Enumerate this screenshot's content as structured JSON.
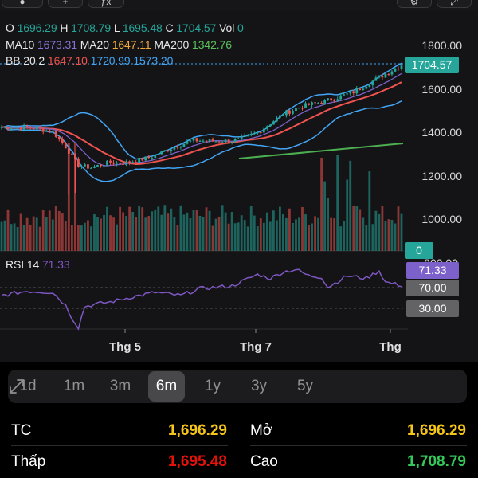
{
  "toolbar": {
    "indicator_label": "ƒx"
  },
  "legend": {
    "ohlc": {
      "o_label": "O",
      "o": "1696.29",
      "h_label": "H",
      "h": "1708.79",
      "l_label": "L",
      "l": "1695.48",
      "c_label": "C",
      "c": "1704.57",
      "vol_label": "Vol",
      "vol": "0"
    },
    "ma": {
      "ma10_label": "MA10",
      "ma10": "1673.31",
      "ma20_label": "MA20",
      "ma20": "1647.11",
      "ma200_label": "MA200",
      "ma200": "1342.76"
    },
    "bb": {
      "label": "BB 20 2",
      "middle": "1647.10",
      "upper": "1720.99",
      "lower": "1573.20"
    },
    "rsi": {
      "label": "RSI 14",
      "value": "71.33"
    }
  },
  "price_axis": {
    "ticks": [
      "1800.00",
      "1600.00",
      "1400.00",
      "1200.00",
      "1000.00"
    ],
    "current_price": "1704.57",
    "volume_current": "0",
    "rsi_partial_tick": "800.00"
  },
  "rsi_axis": {
    "current": "71.33",
    "overbought": "70.00",
    "oversold": "30.00"
  },
  "time_axis": [
    "Thg 5",
    "Thg 7",
    "Thg"
  ],
  "periods": [
    {
      "label": "1d",
      "active": false
    },
    {
      "label": "1m",
      "active": false
    },
    {
      "label": "3m",
      "active": false
    },
    {
      "label": "6m",
      "active": true
    },
    {
      "label": "1y",
      "active": false
    },
    {
      "label": "3y",
      "active": false
    },
    {
      "label": "5y",
      "active": false
    }
  ],
  "stats": {
    "tc_label": "TC",
    "tc": "1,696.29",
    "open_label": "Mở",
    "open": "1,696.29",
    "low_label": "Thấp",
    "low": "1,695.48",
    "high_label": "Cao",
    "high": "1,708.79"
  },
  "colors": {
    "up": "#26a69a",
    "down": "#ef5350",
    "ma10": "#7b61c9",
    "ma20": "#f0a93a",
    "ma200": "#4caf50",
    "bb": "#42a5f5",
    "ref": "#f5c518",
    "rsi": "#7e57c2"
  },
  "icons": {
    "expand": "expand-diagonal-icon"
  }
}
